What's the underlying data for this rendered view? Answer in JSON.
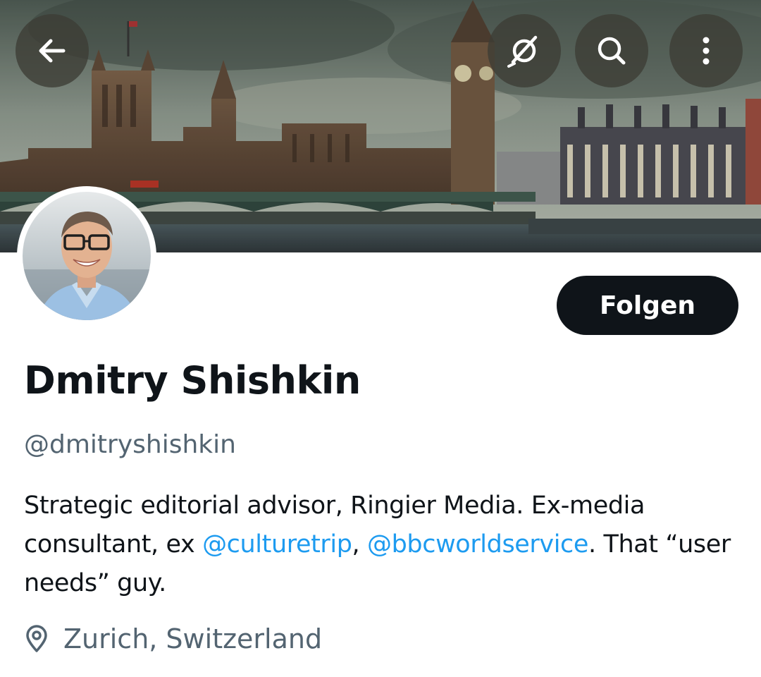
{
  "header": {
    "back_icon": "arrow-left-icon",
    "grok_icon": "grok-icon",
    "search_icon": "search-icon",
    "more_icon": "more-vertical-icon"
  },
  "profile": {
    "follow_label": "Folgen",
    "display_name": "Dmitry Shishkin",
    "handle": "@dmitryshishkin",
    "bio": {
      "text_1": "Strategic editorial advisor, Ringier Media. Ex-media consultant, ex ",
      "mention_1": "@culturetrip",
      "sep": ", ",
      "mention_2": "@bbcworldservice",
      "text_2": ". That “user needs” guy."
    },
    "location": "Zurich, Switzerland",
    "location_icon": "location-pin-icon"
  },
  "colors": {
    "accent": "#1d9bf0",
    "text": "#0f1419",
    "muted": "#536471",
    "button": "#0f1419"
  }
}
